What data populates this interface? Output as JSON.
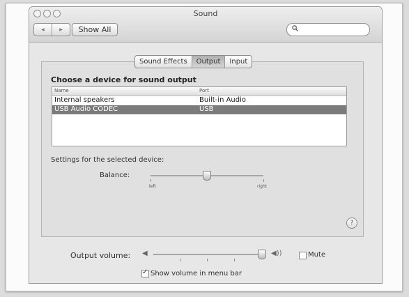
{
  "window": {
    "title": "Sound"
  },
  "toolbar": {
    "back_glyph": "◂",
    "forward_glyph": "▸",
    "show_all_label": "Show All",
    "search_placeholder": "",
    "search_icon": "magnifier-icon"
  },
  "tabs": [
    {
      "label": "Sound Effects",
      "active": false
    },
    {
      "label": "Output",
      "active": true
    },
    {
      "label": "Input",
      "active": false
    }
  ],
  "output": {
    "heading": "Choose a device for sound output",
    "columns": {
      "name": "Name",
      "port": "Port"
    },
    "devices": [
      {
        "name": "Internal speakers",
        "port": "Built-in Audio",
        "selected": false
      },
      {
        "name": "USB Audio CODEC",
        "port": "USB",
        "selected": true
      }
    ],
    "settings_label": "Settings for the selected device:",
    "balance": {
      "label": "Balance:",
      "left": "left",
      "right": "right",
      "value": 0.5
    }
  },
  "help_label": "?",
  "volume": {
    "label": "Output volume:",
    "low_icon": "speaker-low-icon",
    "high_icon": "speaker-high-icon",
    "low_glyph": "◀",
    "high_glyph": "◀))",
    "value": 1.0,
    "mute_label": "Mute",
    "mute_checked": false,
    "show_in_menu_label": "Show volume in menu bar",
    "show_in_menu_checked": true
  }
}
